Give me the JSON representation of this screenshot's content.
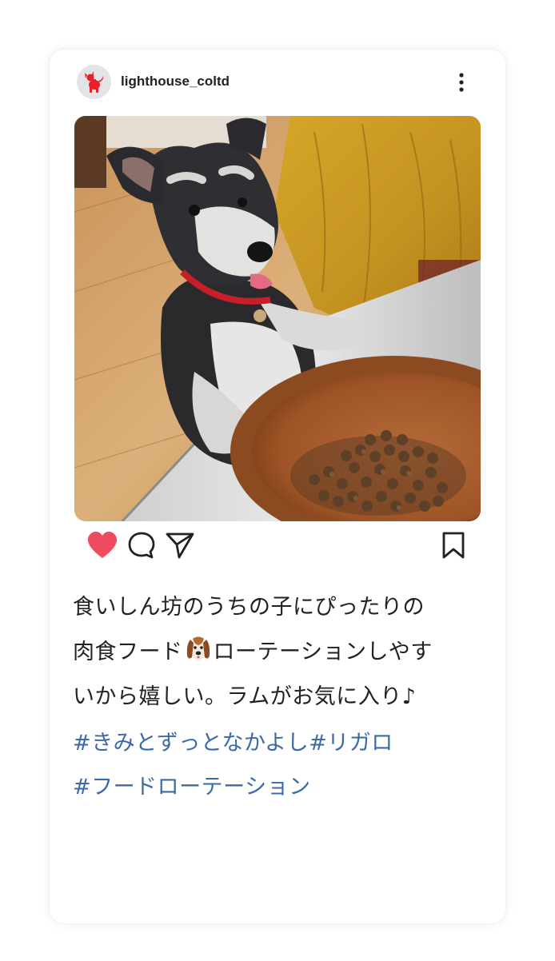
{
  "post": {
    "username": "lighthouse_coltd",
    "avatar_icon": "red-dog-logo",
    "caption_lines": [
      "食いしん坊のうちの子にぴったりの",
      "肉食フード",
      "ローテーションしやす",
      "いから嬉しい。ラムがお気に入り♪"
    ],
    "caption_emoji": "dog-face-emoji",
    "hashtags": [
      "#きみとずっとなかよし#リガロ",
      "#フードローテーション"
    ],
    "liked": true
  },
  "colors": {
    "like": "#f04a5e",
    "hashtag": "#3b6aa8",
    "brand": "#e8202a"
  }
}
